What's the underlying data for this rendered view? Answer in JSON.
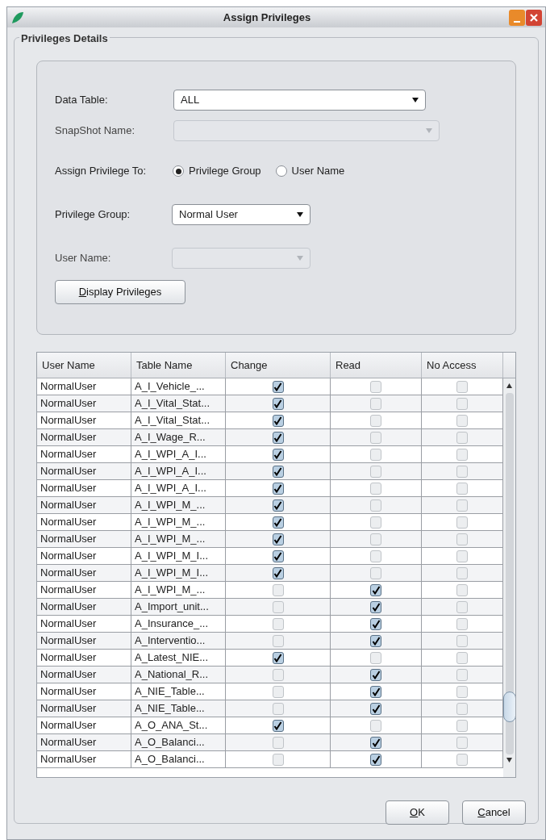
{
  "window": {
    "title": "Assign Privileges"
  },
  "group": {
    "title": "Privileges Details"
  },
  "form": {
    "data_table": {
      "label": "Data Table:",
      "value": "ALL",
      "disabled": false
    },
    "snapshot": {
      "label": "SnapShot Name:",
      "disabled": true
    },
    "assign_to": {
      "label": "Assign Privilege To:",
      "options": [
        {
          "label": "Privilege Group",
          "selected": true
        },
        {
          "label": "User Name",
          "selected": false
        }
      ]
    },
    "privilege_group": {
      "label": "Privilege Group:",
      "value": "Normal User",
      "disabled": false
    },
    "user_name": {
      "label": "User Name:",
      "disabled": true
    },
    "display_button": {
      "mnemonic": "D",
      "rest": "isplay Privileges"
    }
  },
  "table": {
    "columns": [
      "User Name",
      "Table Name",
      "Change",
      "Read",
      "No Access"
    ],
    "rows": [
      {
        "user": "NormalUser",
        "table": "A_I_Vehicle_...",
        "change": true,
        "read": false,
        "no_access": false
      },
      {
        "user": "NormalUser",
        "table": "A_I_Vital_Stat...",
        "change": true,
        "read": false,
        "no_access": false
      },
      {
        "user": "NormalUser",
        "table": "A_I_Vital_Stat...",
        "change": true,
        "read": false,
        "no_access": false
      },
      {
        "user": "NormalUser",
        "table": "A_I_Wage_R...",
        "change": true,
        "read": false,
        "no_access": false
      },
      {
        "user": "NormalUser",
        "table": "A_I_WPI_A_I...",
        "change": true,
        "read": false,
        "no_access": false
      },
      {
        "user": "NormalUser",
        "table": "A_I_WPI_A_I...",
        "change": true,
        "read": false,
        "no_access": false
      },
      {
        "user": "NormalUser",
        "table": "A_I_WPI_A_I...",
        "change": true,
        "read": false,
        "no_access": false
      },
      {
        "user": "NormalUser",
        "table": "A_I_WPI_M_...",
        "change": true,
        "read": false,
        "no_access": false
      },
      {
        "user": "NormalUser",
        "table": "A_I_WPI_M_...",
        "change": true,
        "read": false,
        "no_access": false
      },
      {
        "user": "NormalUser",
        "table": "A_I_WPI_M_...",
        "change": true,
        "read": false,
        "no_access": false
      },
      {
        "user": "NormalUser",
        "table": "A_I_WPI_M_I...",
        "change": true,
        "read": false,
        "no_access": false
      },
      {
        "user": "NormalUser",
        "table": "A_I_WPI_M_I...",
        "change": true,
        "read": false,
        "no_access": false
      },
      {
        "user": "NormalUser",
        "table": "A_I_WPI_M_...",
        "change": false,
        "read": true,
        "no_access": false
      },
      {
        "user": "NormalUser",
        "table": "A_Import_unit...",
        "change": false,
        "read": true,
        "no_access": false
      },
      {
        "user": "NormalUser",
        "table": "A_Insurance_...",
        "change": false,
        "read": true,
        "no_access": false
      },
      {
        "user": "NormalUser",
        "table": "A_Interventio...",
        "change": false,
        "read": true,
        "no_access": false
      },
      {
        "user": "NormalUser",
        "table": "A_Latest_NIE...",
        "change": true,
        "read": false,
        "no_access": false
      },
      {
        "user": "NormalUser",
        "table": "A_National_R...",
        "change": false,
        "read": true,
        "no_access": false
      },
      {
        "user": "NormalUser",
        "table": "A_NIE_Table...",
        "change": false,
        "read": true,
        "no_access": false
      },
      {
        "user": "NormalUser",
        "table": "A_NIE_Table...",
        "change": false,
        "read": true,
        "no_access": false
      },
      {
        "user": "NormalUser",
        "table": "A_O_ANA_St...",
        "change": true,
        "read": false,
        "no_access": false
      },
      {
        "user": "NormalUser",
        "table": "A_O_Balanci...",
        "change": false,
        "read": true,
        "no_access": false
      },
      {
        "user": "NormalUser",
        "table": "A_O_Balanci...",
        "change": false,
        "read": true,
        "no_access": false
      }
    ]
  },
  "buttons": [
    {
      "mnemonic": "O",
      "rest": "K"
    },
    {
      "mnemonic": "C",
      "rest": "ancel"
    }
  ]
}
